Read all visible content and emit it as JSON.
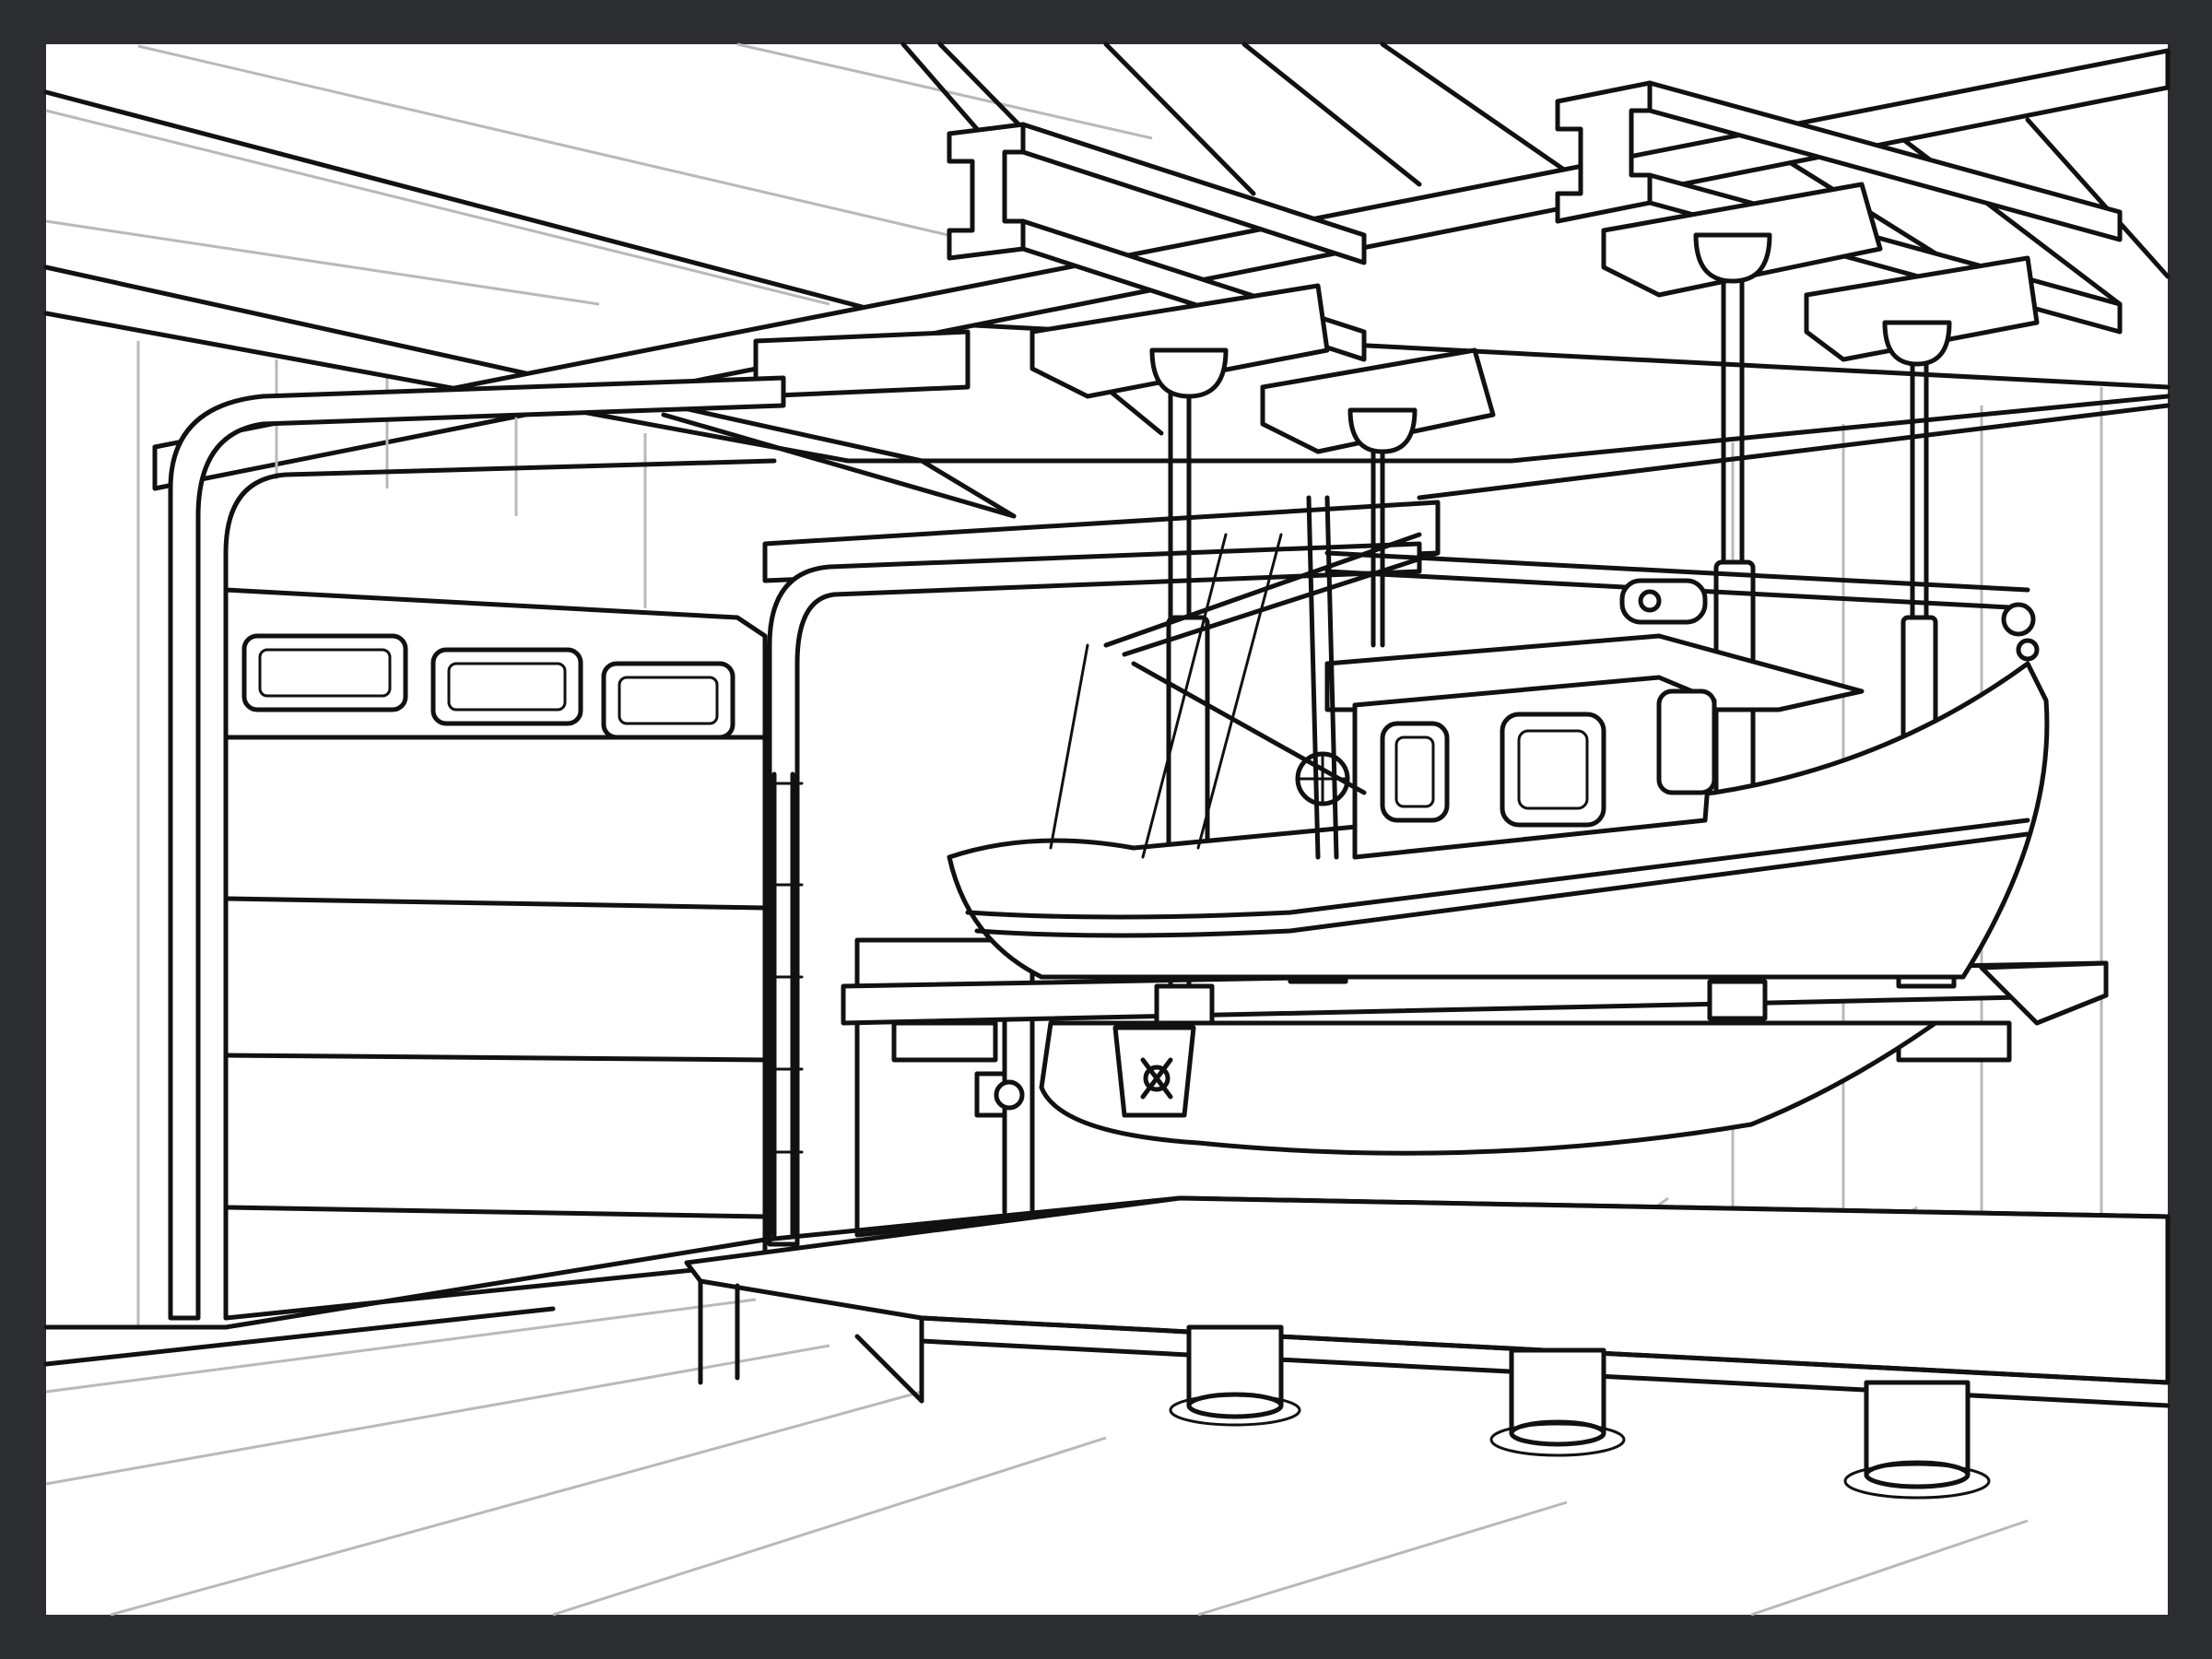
{
  "scene": {
    "subject": "boat-hoist-garage-coloring-page",
    "colors": {
      "frame": "#2b2d31",
      "paper": "#ffffff",
      "ink": "#111111",
      "guide": "#b9b9b9"
    }
  }
}
